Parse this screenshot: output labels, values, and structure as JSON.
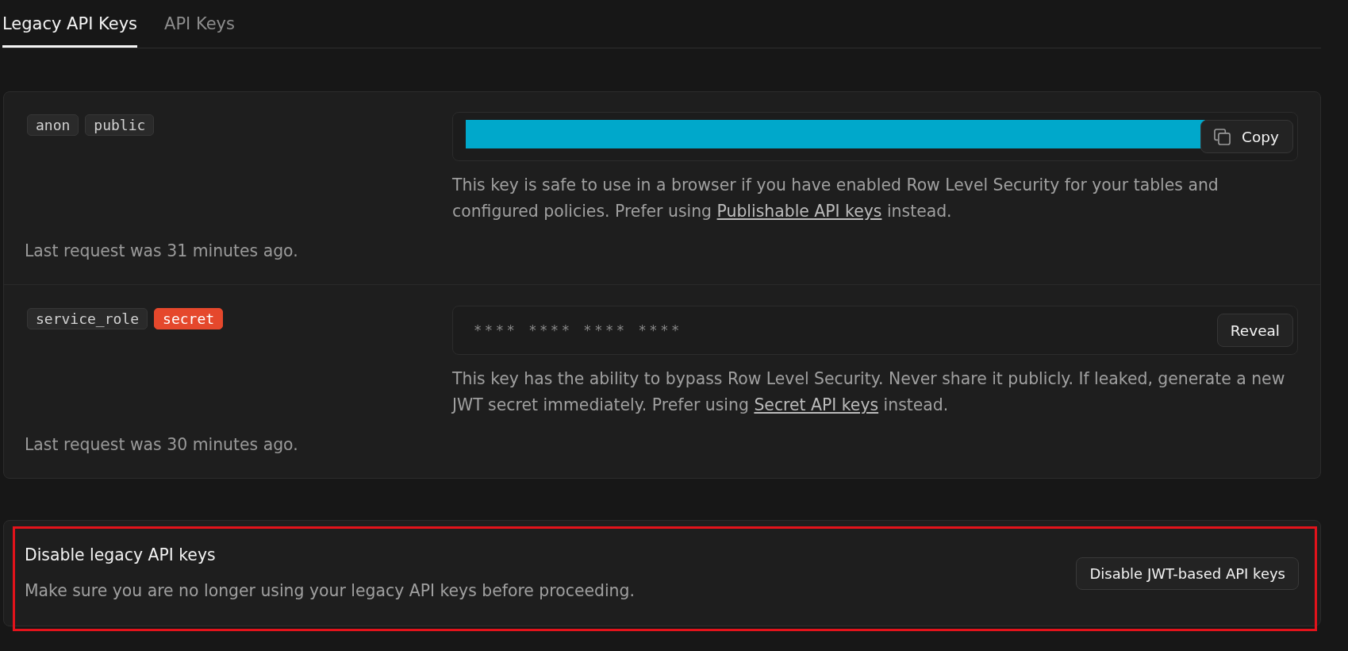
{
  "tabs": [
    {
      "label": "Legacy API Keys",
      "selected": true
    },
    {
      "label": "API Keys",
      "selected": false
    }
  ],
  "legacy_keys": [
    {
      "tags": [
        {
          "label": "anon",
          "kind": "plain"
        },
        {
          "label": "public",
          "kind": "plain"
        }
      ],
      "key_field": {
        "kind": "redacted",
        "button": "Copy"
      },
      "description": {
        "before": "This key is safe to use in a browser if you have enabled Row Level Security for your tables and configured policies. Prefer using ",
        "link": "Publishable API keys",
        "after": " instead."
      },
      "last_request": "Last request was 31 minutes ago."
    },
    {
      "tags": [
        {
          "label": "service_role",
          "kind": "plain"
        },
        {
          "label": "secret",
          "kind": "danger"
        }
      ],
      "key_field": {
        "kind": "masked",
        "value": "**** **** **** ****",
        "button": "Reveal"
      },
      "description": {
        "before": "This key has the ability to bypass Row Level Security. Never share it publicly. If leaked, generate a new JWT secret immediately. Prefer using ",
        "link": "Secret API keys",
        "after": " instead."
      },
      "last_request": "Last request was 30 minutes ago."
    }
  ],
  "disable_section": {
    "title": "Disable legacy API keys",
    "description": "Make sure you are no longer using your legacy API keys before proceeding.",
    "button": "Disable JWT-based API keys",
    "highlighted": true
  }
}
